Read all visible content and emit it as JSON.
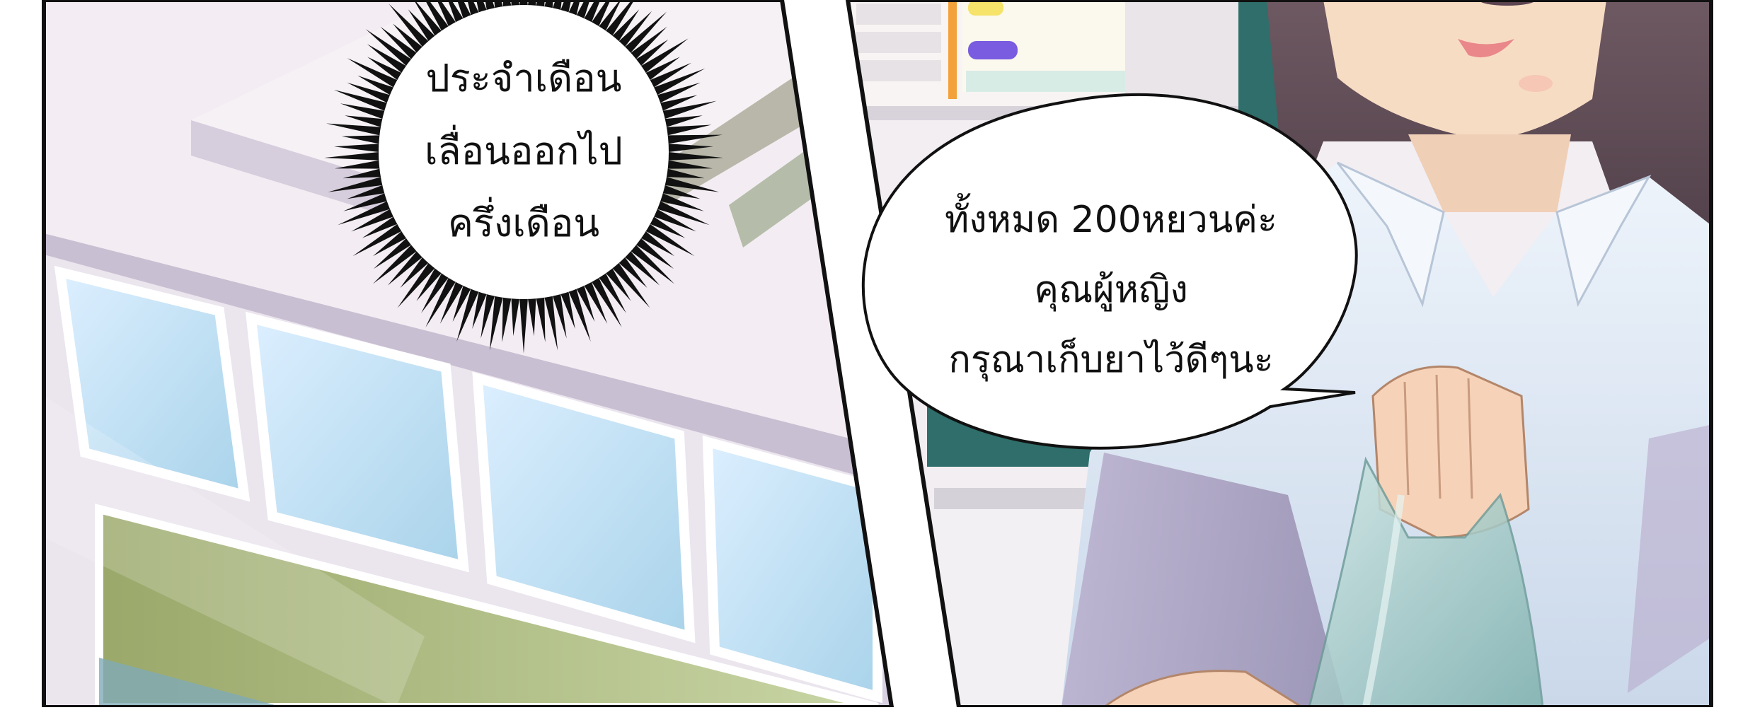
{
  "panels": [
    {
      "id": "left",
      "scene": "building-exterior",
      "thought_bubble": {
        "lines": [
          "ประจำเดือน",
          "เลื่อนออกไป",
          "ครึ่งเดือน"
        ]
      }
    },
    {
      "id": "right",
      "scene": "pharmacy-counter",
      "speech_bubble": {
        "lines": [
          "ทั้งหมด 200หยวนค่ะ",
          "คุณผู้หญิง",
          "กรุณาเก็บยาไว้ดีๆนะ"
        ]
      }
    }
  ],
  "colors": {
    "sky_glass": "#bfe0f2",
    "building_wall": "#ece6f1",
    "wall_shadow": "#c9c1d6",
    "shirt": "#dfeaf6",
    "hair": "#5a4650",
    "skin": "#f6dcc6",
    "teal_board": "#2f6e6a",
    "bag": "#9fc7c6"
  }
}
